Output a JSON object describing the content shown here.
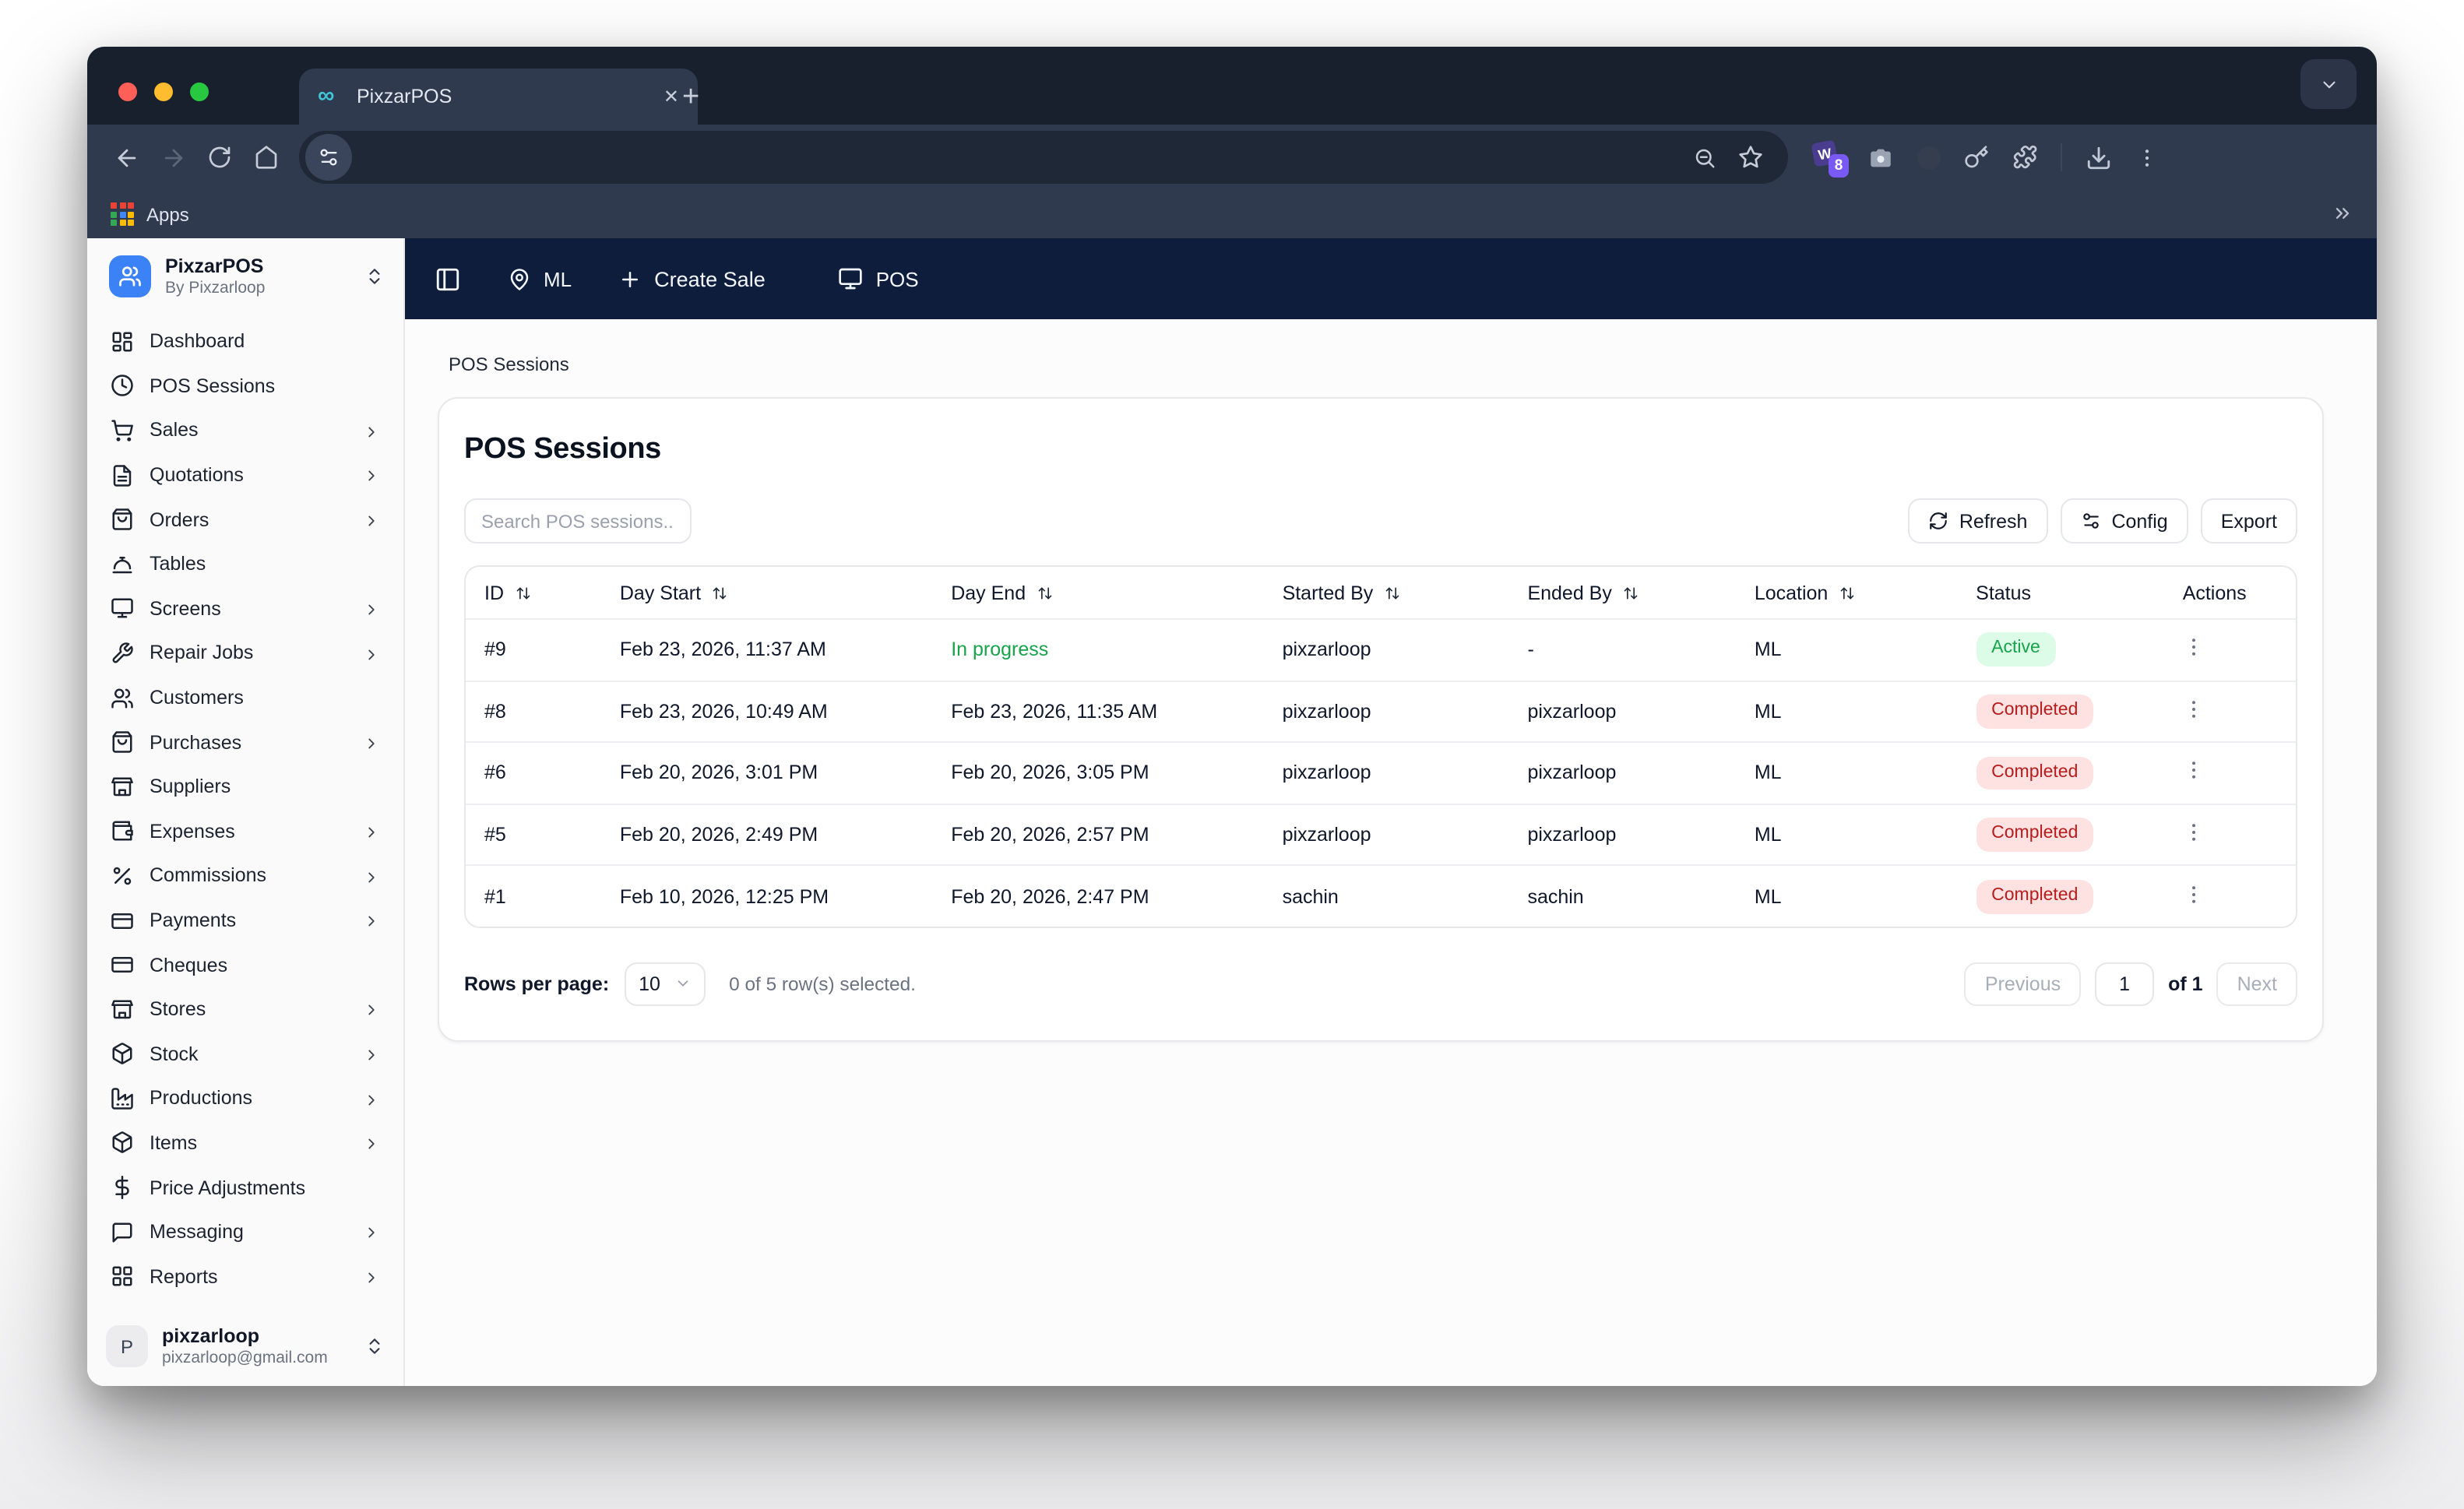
{
  "browser": {
    "tab_title": "PixzarPOS",
    "new_tab_glyph": "+",
    "close_glyph": "✕",
    "favicon_glyph": "∞",
    "bookmarks": {
      "apps_label": "Apps"
    },
    "extensions": {
      "wappalyzer_letter": "W",
      "wappalyzer_badge": "8"
    }
  },
  "topbar": {
    "location_label": "ML",
    "create_sale_label": "Create Sale",
    "pos_label": "POS"
  },
  "sidebar": {
    "app_name": "PixzarPOS",
    "app_byline": "By Pixzarloop",
    "items": [
      {
        "label": "Dashboard",
        "icon": "dashboard",
        "chevron": false
      },
      {
        "label": "POS Sessions",
        "icon": "clock",
        "chevron": false
      },
      {
        "label": "Sales",
        "icon": "cart",
        "chevron": true
      },
      {
        "label": "Quotations",
        "icon": "file-text",
        "chevron": true
      },
      {
        "label": "Orders",
        "icon": "shopping-bag",
        "chevron": true
      },
      {
        "label": "Tables",
        "icon": "bell",
        "chevron": false
      },
      {
        "label": "Screens",
        "icon": "monitor",
        "chevron": true
      },
      {
        "label": "Repair Jobs",
        "icon": "wrench",
        "chevron": true
      },
      {
        "label": "Customers",
        "icon": "users",
        "chevron": false
      },
      {
        "label": "Purchases",
        "icon": "shopping-bag",
        "chevron": true
      },
      {
        "label": "Suppliers",
        "icon": "store",
        "chevron": false
      },
      {
        "label": "Expenses",
        "icon": "wallet",
        "chevron": true
      },
      {
        "label": "Commissions",
        "icon": "percent",
        "chevron": true
      },
      {
        "label": "Payments",
        "icon": "credit-card",
        "chevron": true
      },
      {
        "label": "Cheques",
        "icon": "credit-card",
        "chevron": false
      },
      {
        "label": "Stores",
        "icon": "store",
        "chevron": true
      },
      {
        "label": "Stock",
        "icon": "package",
        "chevron": true
      },
      {
        "label": "Productions",
        "icon": "factory",
        "chevron": true
      },
      {
        "label": "Items",
        "icon": "package",
        "chevron": true
      },
      {
        "label": "Price Adjustments",
        "icon": "dollar",
        "chevron": false
      },
      {
        "label": "Messaging",
        "icon": "message-square",
        "chevron": true
      },
      {
        "label": "Reports",
        "icon": "grid",
        "chevron": true
      }
    ],
    "user": {
      "initial": "P",
      "name": "pixzarloop",
      "email": "pixzarloop@gmail.com"
    }
  },
  "breadcrumb": "POS Sessions",
  "page": {
    "title": "POS Sessions",
    "search_placeholder": "Search POS sessions...",
    "buttons": {
      "refresh": "Refresh",
      "config": "Config",
      "export": "Export"
    },
    "table": {
      "columns": [
        {
          "label": "ID",
          "sortable": true
        },
        {
          "label": "Day Start",
          "sortable": true
        },
        {
          "label": "Day End",
          "sortable": true
        },
        {
          "label": "Started By",
          "sortable": true
        },
        {
          "label": "Ended By",
          "sortable": true
        },
        {
          "label": "Location",
          "sortable": true
        },
        {
          "label": "Status",
          "sortable": false
        },
        {
          "label": "Actions",
          "sortable": false
        }
      ],
      "rows": [
        {
          "id": "#9",
          "day_start": "Feb 23, 2026, 11:37 AM",
          "day_end": "In progress",
          "in_progress": true,
          "started_by": "pixzarloop",
          "ended_by": "-",
          "location": "ML",
          "status": "Active"
        },
        {
          "id": "#8",
          "day_start": "Feb 23, 2026, 10:49 AM",
          "day_end": "Feb 23, 2026, 11:35 AM",
          "in_progress": false,
          "started_by": "pixzarloop",
          "ended_by": "pixzarloop",
          "location": "ML",
          "status": "Completed"
        },
        {
          "id": "#6",
          "day_start": "Feb 20, 2026, 3:01 PM",
          "day_end": "Feb 20, 2026, 3:05 PM",
          "in_progress": false,
          "started_by": "pixzarloop",
          "ended_by": "pixzarloop",
          "location": "ML",
          "status": "Completed"
        },
        {
          "id": "#5",
          "day_start": "Feb 20, 2026, 2:49 PM",
          "day_end": "Feb 20, 2026, 2:57 PM",
          "in_progress": false,
          "started_by": "pixzarloop",
          "ended_by": "pixzarloop",
          "location": "ML",
          "status": "Completed"
        },
        {
          "id": "#1",
          "day_start": "Feb 10, 2026, 12:25 PM",
          "day_end": "Feb 20, 2026, 2:47 PM",
          "in_progress": false,
          "started_by": "sachin",
          "ended_by": "sachin",
          "location": "ML",
          "status": "Completed"
        }
      ]
    },
    "pagination": {
      "rows_per_page_label": "Rows per page:",
      "rows_per_page_value": "10",
      "selection_text": "0 of 5 row(s) selected.",
      "previous_label": "Previous",
      "page_value": "1",
      "of_label": "of 1",
      "next_label": "Next"
    }
  },
  "colors": {
    "accent_blue": "#3b82f6",
    "navy_bar": "#0f1d3d",
    "active_text": "#16a34a",
    "active_bg": "#dcfce7",
    "completed_text": "#b91c1c",
    "completed_bg": "#fee2e2"
  }
}
